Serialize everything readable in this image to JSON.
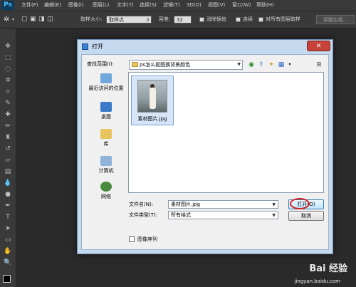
{
  "app": {
    "logo": "Ps"
  },
  "menu": [
    "文件(F)",
    "编辑(E)",
    "图像(I)",
    "图层(L)",
    "文字(Y)",
    "选择(S)",
    "滤镜(T)",
    "3D(D)",
    "视图(V)",
    "窗口(W)",
    "帮助(H)"
  ],
  "options": {
    "sample_size_label": "取样大小:",
    "sample_size_value": "取样点",
    "tolerance_label": "容差:",
    "tolerance_value": "32",
    "antialias_label": "消除锯齿",
    "contiguous_label": "连续",
    "all_layers_label": "对所有图层取样",
    "refine_edge_button": "调整边缘..."
  },
  "dialog": {
    "title": "打开",
    "close_glyph": "✕",
    "look_in_label": "查找范围(I):",
    "look_in_value": "ps怎么抠图换背景颜色",
    "places": [
      {
        "label": "最近访问的位置",
        "icon": "recent-places-icon"
      },
      {
        "label": "桌面",
        "icon": "desktop-icon"
      },
      {
        "label": "库",
        "icon": "libraries-icon"
      },
      {
        "label": "计算机",
        "icon": "computer-icon"
      },
      {
        "label": "网络",
        "icon": "network-icon"
      }
    ],
    "files": [
      {
        "name": "素材图片.jpg"
      }
    ],
    "filename_label": "文件名(N):",
    "filename_value": "素材图片.jpg",
    "filetype_label": "文件类型(T):",
    "filetype_value": "所有格式",
    "open_button": "打开(O)",
    "cancel_button": "取消",
    "image_sequence_label": "图像序列"
  },
  "watermark": {
    "brand": "Bai 经验",
    "url": "jingyan.baidu.com"
  },
  "colors": {
    "dialog_frame": "#c5d9ef",
    "close_button": "#c7433a",
    "highlight_ring": "#d42222"
  }
}
